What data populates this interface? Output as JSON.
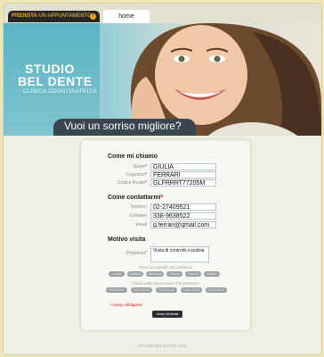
{
  "topbar": {
    "book_label": "PRENOTA",
    "book_sub": "UN APPUNTAMENTO",
    "home_tab": "home"
  },
  "hero": {
    "logo_line1": "STUDIO",
    "logo_line2": "BEL DENTE",
    "logo_line3": "CLINICA ODONTOIATRICA",
    "slogan": "Vuoi un sorriso migliore?"
  },
  "form": {
    "sections": {
      "name": "Come mi chiamo",
      "contact": "Come contattarmi",
      "reason": "Motivo visita"
    },
    "fields": {
      "nome": {
        "label": "Nome",
        "value": "GIULIA"
      },
      "cognome": {
        "label": "Cognome",
        "value": "FERRARI"
      },
      "codice_fiscale": {
        "label": "Codice fiscale",
        "value": "GLFRRRT77205M"
      },
      "telefono": {
        "label": "Telefono",
        "value": "02-27409521"
      },
      "cellulare": {
        "label": "Cellulare",
        "value": "338-9638522"
      },
      "email": {
        "label": "Email",
        "value": "g.ferrari@gmail.com"
      },
      "problema": {
        "label": "Problema",
        "value": "Visita di controllo e pulizia"
      }
    },
    "days_hint": "Clicca sui giorni/ che preferisci",
    "times_hint": "Clicca sulle fasce orarie che preferisci",
    "days": [
      "Lunedì",
      "Martedì",
      "Mercoledì",
      "Giovedì",
      "Venerdì",
      "Sabato"
    ],
    "times": [
      "8:00-10:00",
      "10:00-12:00",
      "12:00-14:00",
      "14:00-16:00",
      "16:00-18:00"
    ],
    "required_note": "* campi obbligatori",
    "submit": "Invia richiesta"
  },
  "footer": "STUDIO BEL DENTE 2010"
}
